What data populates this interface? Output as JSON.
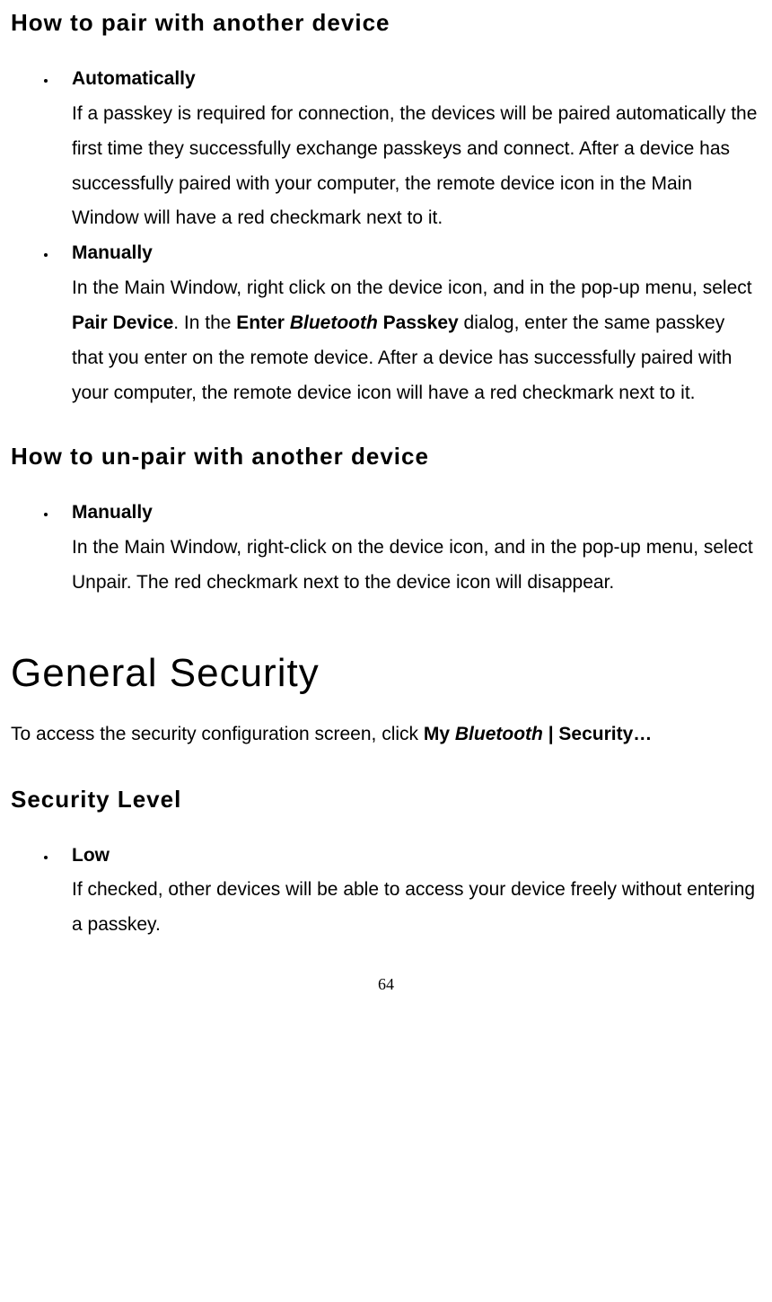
{
  "section1": {
    "heading": "How to pair with another device",
    "items": [
      {
        "title": "Automatically",
        "body_html": "If a passkey is required for connection, the devices will be paired automatically the first time they successfully exchange passkeys and connect. After a device has successfully paired with your computer, the remote device icon in the Main Window will have a red checkmark next to it."
      },
      {
        "title": "Manually",
        "body_html": "In the Main Window, right click on the device icon, and in the pop-up menu, select <b>Pair Device</b>. In the <b>Enter <i>Bluetooth</i> Passkey</b> dialog, enter the same passkey that you enter on the remote device. After a device has successfully paired with your computer, the remote device icon will have a red checkmark next to it."
      }
    ]
  },
  "section2": {
    "heading": "How to un-pair with another device",
    "items": [
      {
        "title": "Manually",
        "body_html": "In the Main Window, right-click on the device icon, and in the pop-up menu, select Unpair. The red checkmark next to the device icon will disappear."
      }
    ]
  },
  "section3": {
    "heading": "General Security",
    "intro_html": "To access the security configuration screen, click <b>My <i>Bluetooth</i> | Security…</b>"
  },
  "section4": {
    "heading": "Security Level",
    "items": [
      {
        "title": "Low",
        "body_html": "If checked, other devices will be able to access your device freely without entering a passkey."
      }
    ]
  },
  "page_number": "64"
}
